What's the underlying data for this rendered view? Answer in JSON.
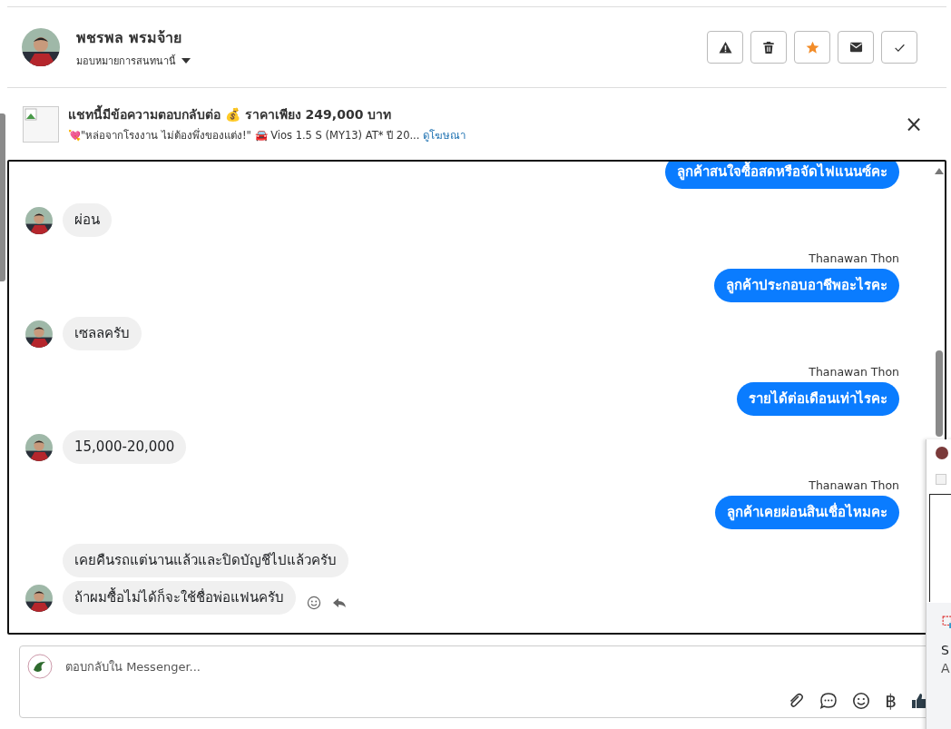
{
  "header": {
    "name": "พชรพล พรมจ้าย",
    "assign_label": "มอบหมายการสนทนานี้",
    "actions": [
      {
        "kind": "warning",
        "on": false
      },
      {
        "kind": "trash",
        "on": false
      },
      {
        "kind": "star",
        "on": true
      },
      {
        "kind": "mail",
        "on": false
      },
      {
        "kind": "check",
        "on": false
      }
    ]
  },
  "ad": {
    "title": "แชทนี้มีข้อความตอบกลับต่อ 💰 ราคาเพียง 249,000 บาท",
    "subtitle": "💘\"หล่อจากโรงงาน ไม่ต้องพึ่งของแต่ง!\" 🚘 Vios 1.5 S (MY13) AT* ปี 20...",
    "link": "ดูโฆษณา",
    "close": "×"
  },
  "messages": [
    {
      "kind": "outgoing",
      "text": "ลูกค้าสนใจซื้อสดหรือจัดไฟแนนซ์คะ"
    },
    {
      "kind": "incoming",
      "show_avatar": true,
      "show_actions": false,
      "text": "ผ่อน"
    },
    {
      "kind": "outgoing",
      "sender": "Thanawan Thon",
      "text": "ลูกค้าประกอบอาชีพอะไรคะ"
    },
    {
      "kind": "incoming",
      "show_avatar": true,
      "show_actions": false,
      "text": "เซลลครับ"
    },
    {
      "kind": "outgoing",
      "sender": "Thanawan Thon",
      "text": "รายได้ต่อเดือนเท่าไรคะ"
    },
    {
      "kind": "incoming",
      "show_avatar": true,
      "show_actions": false,
      "text": "15,000-20,000"
    },
    {
      "kind": "outgoing",
      "sender": "Thanawan Thon",
      "text": "ลูกค้าเคยผ่อนสินเชื่อไหมคะ"
    },
    {
      "kind": "incoming",
      "show_avatar": false,
      "show_actions": false,
      "text": "เคยคืนรถแต่นานแล้วและปิดบัญชีไปแล้วครับ"
    },
    {
      "kind": "incoming",
      "show_avatar": true,
      "show_actions": true,
      "text": "ถ้าผมซื้อไม่ได้ก็จะใช้ชื่อพ่อแฟนครับ"
    }
  ],
  "composer": {
    "placeholder": "ตอบกลับใน Messenger...",
    "baht": "฿"
  },
  "side_popup": {
    "line_1": "S",
    "line_2": "A"
  }
}
